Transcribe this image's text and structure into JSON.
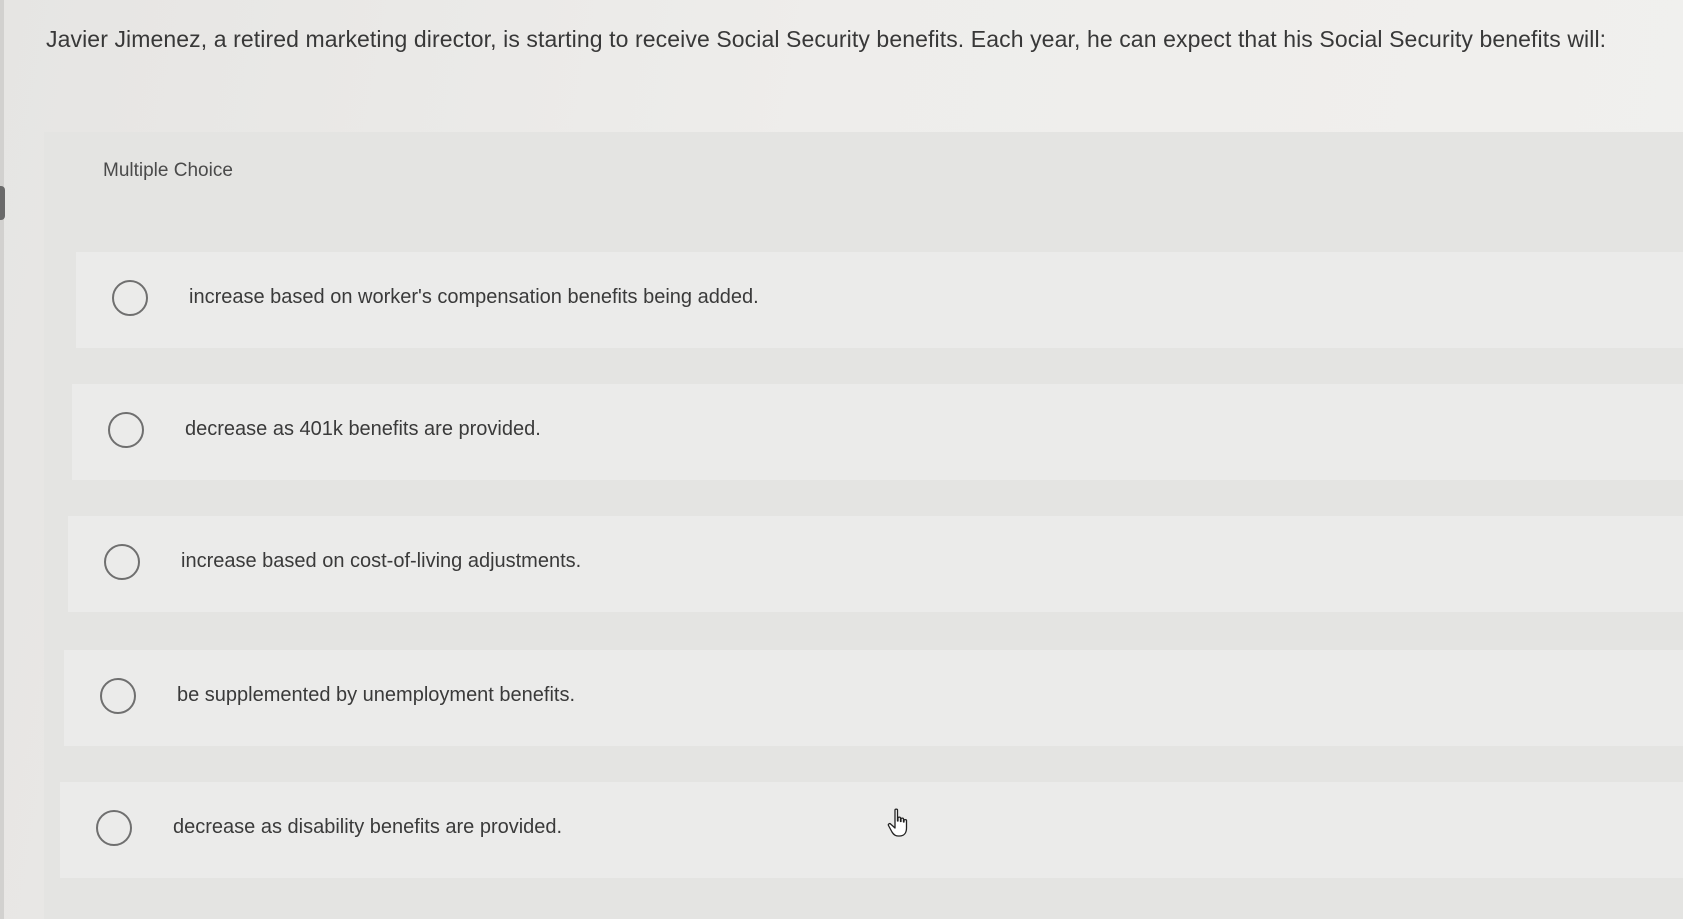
{
  "question": {
    "text": "Javier Jimenez, a retired marketing director, is starting to receive Social Security benefits. Each year, he can expect that his Social Security benefits will:"
  },
  "answer_panel": {
    "label": "Multiple Choice",
    "options": [
      {
        "text": "increase based on worker's compensation benefits being added."
      },
      {
        "text": "decrease as 401k benefits are provided."
      },
      {
        "text": "increase based on cost-of-living adjustments."
      },
      {
        "text": "be supplemented by unemployment benefits."
      },
      {
        "text": "decrease as disability benefits are provided."
      }
    ]
  },
  "icons": {
    "radio": "radio-circle-unselected",
    "cursor": "hand-pointer-cursor"
  },
  "colors": {
    "background": "#e9e8e6",
    "panel": "#e4e4e2",
    "option_row": "#ebebea",
    "text": "#3a3a3a"
  }
}
